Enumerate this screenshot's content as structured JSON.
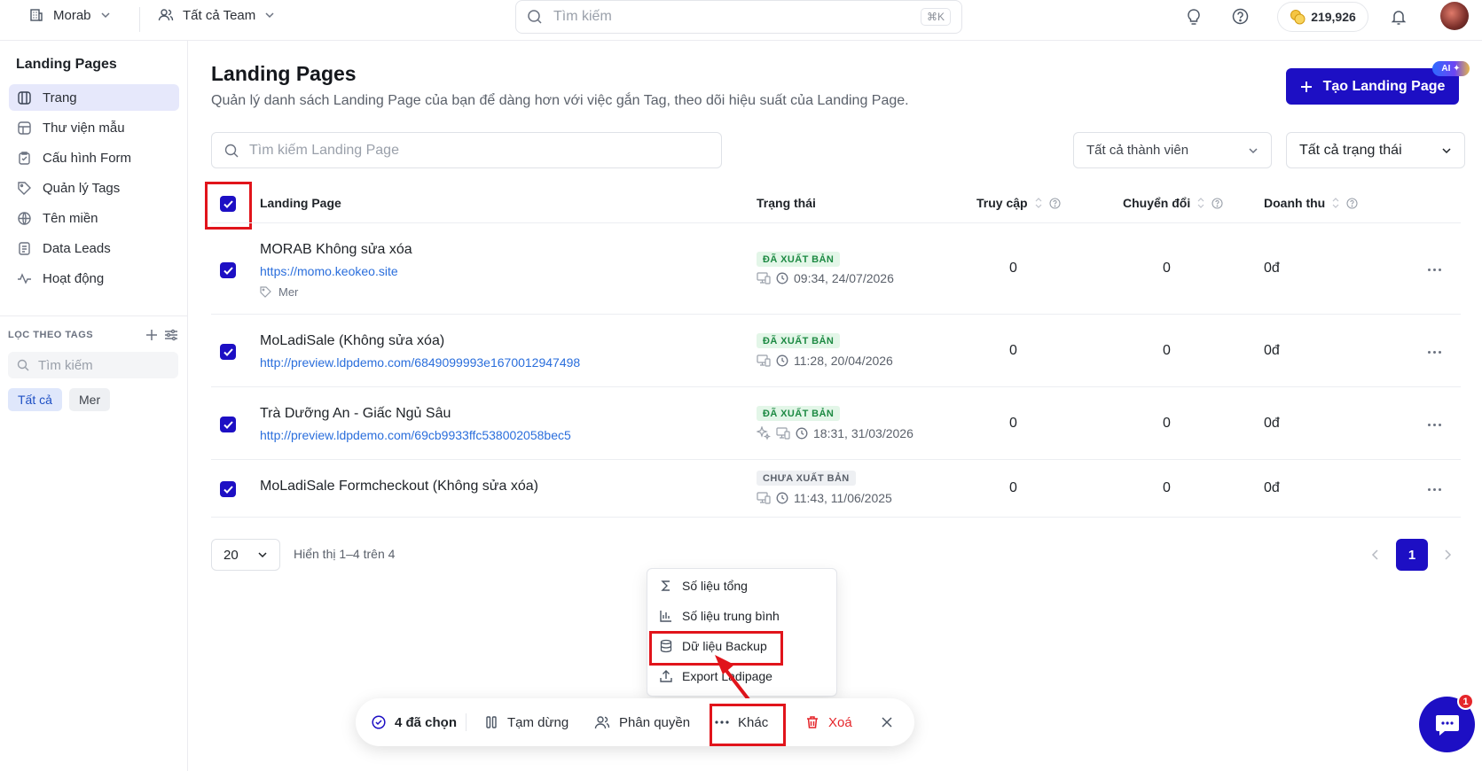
{
  "topbar": {
    "workspace": "Morab",
    "team": "Tất cả Team",
    "search_placeholder": "Tìm kiếm",
    "search_shortcut": "⌘K",
    "credits": "219,926"
  },
  "sidebar": {
    "title": "Landing Pages",
    "items": [
      {
        "label": "Trang",
        "icon": "pages-icon",
        "active": true
      },
      {
        "label": "Thư viện mẫu",
        "icon": "template-icon"
      },
      {
        "label": "Cấu hình Form",
        "icon": "form-icon"
      },
      {
        "label": "Quản lý Tags",
        "icon": "tag-icon"
      },
      {
        "label": "Tên miền",
        "icon": "globe-icon"
      },
      {
        "label": "Data Leads",
        "icon": "document-icon"
      },
      {
        "label": "Hoạt động",
        "icon": "activity-icon"
      }
    ],
    "tag_filter": {
      "heading": "LỌC THEO TAGS",
      "search_placeholder": "Tìm kiếm",
      "chips": [
        "Tất cả",
        "Mer"
      ]
    }
  },
  "main": {
    "title": "Landing Pages",
    "subtitle": "Quản lý danh sách Landing Page của bạn để dàng hơn với việc gắn Tag, theo dõi hiệu suất của Landing Page.",
    "create_button": "Tạo Landing Page",
    "ai_badge": "AI",
    "search_placeholder": "Tìm kiếm Landing Page",
    "member_filter": "Tất cả thành viên",
    "status_filter": "Tất cả trạng thái",
    "columns": {
      "page": "Landing Page",
      "status": "Trạng thái",
      "visits": "Truy cập",
      "conversions": "Chuyển đổi",
      "revenue": "Doanh thu"
    },
    "rows": [
      {
        "name": "MORAB Không sửa xóa",
        "url": "https://momo.keokeo.site",
        "tag": "Mer",
        "status": "ĐÃ XUẤT BẢN",
        "time": "09:34, 24/07/2026",
        "visits": "0",
        "conversions": "0",
        "revenue": "0đ"
      },
      {
        "name": "MoLadiSale (Không sửa xóa)",
        "url": "http://preview.ldpdemo.com/6849099993e1670012947498",
        "status": "ĐÃ XUẤT BẢN",
        "time": "11:28, 20/04/2026",
        "visits": "0",
        "conversions": "0",
        "revenue": "0đ"
      },
      {
        "name": "Trà Dưỡng An - Giấc Ngủ Sâu",
        "url": "http://preview.ldpdemo.com/69cb9933ffc538002058bec5",
        "status": "ĐÃ XUẤT BẢN",
        "time": "18:31, 31/03/2026",
        "visits": "0",
        "conversions": "0",
        "revenue": "0đ"
      },
      {
        "name": "MoLadiSale Formcheckout (Không sửa xóa)",
        "status": "CHƯA XUẤT BẢN",
        "time": "11:43, 11/06/2025",
        "visits": "0",
        "conversions": "0",
        "revenue": "0đ"
      }
    ],
    "page_size": "20",
    "showing": "Hiển thị 1–4 trên 4",
    "current_page": "1"
  },
  "dropdown": {
    "items": [
      "Số liệu tổng",
      "Số liệu trung bình",
      "Dữ liệu Backup",
      "Export Ladipage"
    ]
  },
  "bulkbar": {
    "selected": "4 đã chọn",
    "pause": "Tạm dừng",
    "permissions": "Phân quyền",
    "more": "Khác",
    "delete": "Xoá"
  },
  "chat": {
    "badge": "1"
  },
  "colors": {
    "accent": "#1d0fc4",
    "highlight": "#e1141b",
    "published": "#1d8a43",
    "link": "#2a6edc",
    "danger": "#e5252a"
  }
}
